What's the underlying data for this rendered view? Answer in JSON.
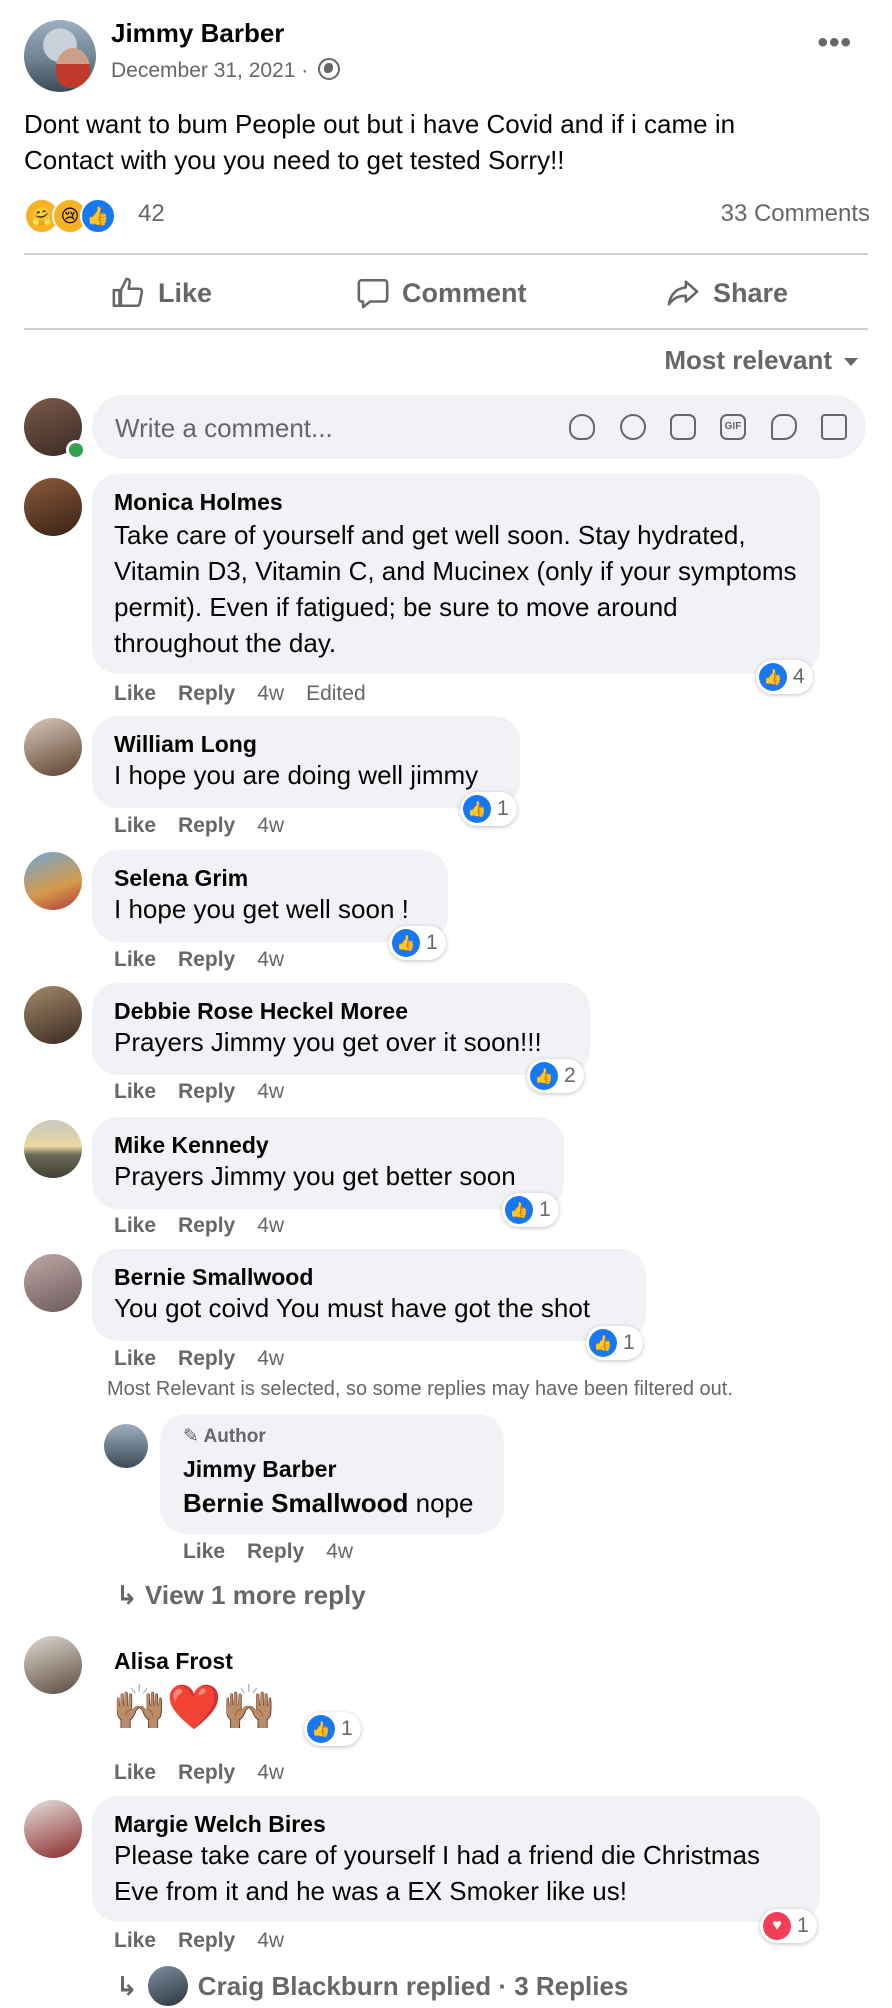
{
  "post": {
    "author": "Jimmy Barber",
    "date": "December 31, 2021 · ",
    "text": "Dont want to bum People out but i have Covid and if i came in Contact with you you need to get tested Sorry!!",
    "reactions_count": "42",
    "comments_count": "33 Comments",
    "more_label": "•••"
  },
  "actions": {
    "like": "Like",
    "comment": "Comment",
    "share": "Share"
  },
  "sort": {
    "label": "Most relevant"
  },
  "composer": {
    "placeholder": "Write a comment...",
    "icons": [
      "avatar-sticker-icon",
      "emoji-icon",
      "camera-icon",
      "gif-icon",
      "sticker-icon",
      "more-sticker-icon"
    ]
  },
  "comments": [
    {
      "name": "Monica Holmes",
      "text": "Take care of yourself and get well soon. Stay hydrated, Vitamin D3, Vitamin C, and Mucinex (only if your symptoms permit). Even if fatigued; be sure to move around throughout the day.",
      "like": "Like",
      "reply": "Reply",
      "time": "4w",
      "edited": "Edited",
      "reactions": "4"
    },
    {
      "name": "William Long",
      "text": "I hope you are doing well jimmy",
      "like": "Like",
      "reply": "Reply",
      "time": "4w",
      "reactions": "1"
    },
    {
      "name": "Selena Grim",
      "text": "I hope you get well soon !",
      "like": "Like",
      "reply": "Reply",
      "time": "4w",
      "reactions": "1"
    },
    {
      "name": "Debbie Rose Heckel Moree",
      "text": "Prayers Jimmy you get over it soon!!!",
      "like": "Like",
      "reply": "Reply",
      "time": "4w",
      "reactions": "2"
    },
    {
      "name": "Mike Kennedy",
      "text": "Prayers Jimmy you get better soon",
      "like": "Like",
      "reply": "Reply",
      "time": "4w",
      "reactions": "1"
    },
    {
      "name": "Bernie Smallwood",
      "text": "You got coivd You must have got the shot",
      "like": "Like",
      "reply": "Reply",
      "time": "4w",
      "reactions": "1"
    },
    {
      "name": "Alisa Frost",
      "text": "🙌🏽❤️🙌🏽",
      "like": "Like",
      "reply": "Reply",
      "time": "4w",
      "reactions": "1"
    },
    {
      "name": "Margie Welch Bires",
      "text": "Please take care of yourself I had a friend die Christmas Eve from it and he was a EX Smoker like us!",
      "like": "Like",
      "reply": "Reply",
      "time": "4w",
      "reactions": "1"
    }
  ],
  "filter_note": "Most Relevant is selected, so some replies may have been filtered out.",
  "reply": {
    "badge": "Author",
    "name": "Jimmy Barber",
    "mention": "Bernie Smallwood",
    "text": " nope",
    "like": "Like",
    "reply": "Reply",
    "time": "4w"
  },
  "view_more": "View 1 more reply",
  "last_reply": "Craig Blackburn replied · 3 Replies",
  "colors": {
    "like_blue": "#1877f2",
    "love_red": "#f33e58",
    "bubble": "#f0f2f5",
    "secondary_text": "#65676b"
  }
}
